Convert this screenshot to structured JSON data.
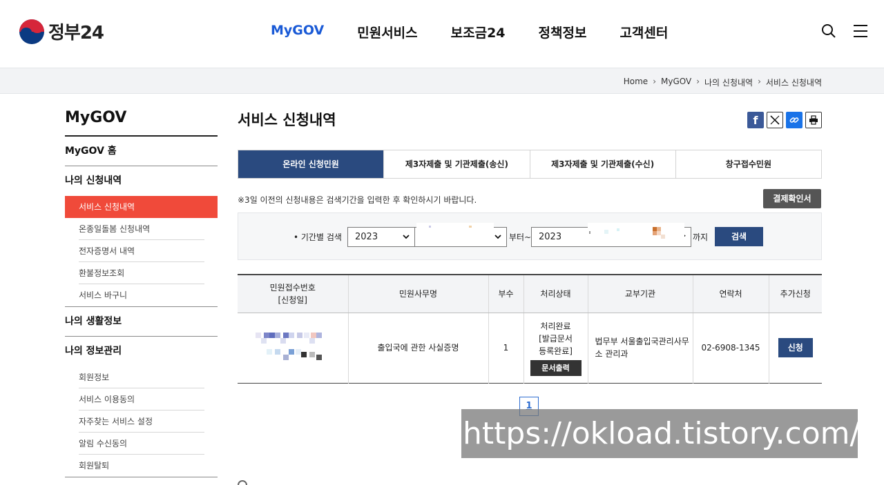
{
  "header": {
    "logo_text": "정부24",
    "nav": [
      "MyGOV",
      "민원서비스",
      "보조금24",
      "정책정보",
      "고객센터"
    ],
    "active_nav": 0
  },
  "breadcrumb": [
    "Home",
    "MyGOV",
    "나의 신청내역",
    "서비스 신청내역"
  ],
  "sidebar": {
    "title": "MyGOV",
    "home": "MyGOV 홈",
    "group1": {
      "label": "나의 신청내역",
      "items": [
        "서비스 신청내역",
        "온종일돌봄 신청내역",
        "전자증명서 내역",
        "환불정보조회",
        "서비스 바구니"
      ]
    },
    "group2": {
      "label": "나의 생활정보"
    },
    "group3": {
      "label": "나의 정보관리",
      "items": [
        "회원정보",
        "서비스 이용동의",
        "자주찾는 서비스 설정",
        "알림 수신동의",
        "회원탈퇴"
      ]
    }
  },
  "main": {
    "title": "서비스 신청내역",
    "tabs": [
      "온라인 신청민원",
      "제3자제출 및 기관제출(송신)",
      "제3자제출 및 기관제출(수신)",
      "창구접수민원"
    ],
    "notice": "※3일 이전의 신청내용은 검색기간을 입력한 후 확인하시기 바랍니다.",
    "receipt_button": "결제확인서",
    "search": {
      "label": "• 기간별 검색",
      "from_year": "2023",
      "to_year": "2023",
      "from_text": "부터~",
      "to_text": "까지",
      "button": "검색"
    },
    "table": {
      "headers": [
        "민원접수번호\n[신청일]",
        "민원사무명",
        "부수",
        "처리상태",
        "교부기관",
        "연락처",
        "추가신청"
      ],
      "row": {
        "name": "출입국에 관한 사실증명",
        "copies": "1",
        "status": "처리완료\n[발급문서\n등록완료]",
        "print_button": "문서출력",
        "agency": "법무부 서울출입국관리사무소 관리과",
        "phone": "02-6908-1345",
        "apply_button": "신청"
      }
    },
    "page": "1"
  },
  "watermark": "https://okload.tistory.com/",
  "colors": {
    "accent": "#1a5ad6",
    "tab_active": "#2a4a7f",
    "side_active": "#f04a3a"
  }
}
